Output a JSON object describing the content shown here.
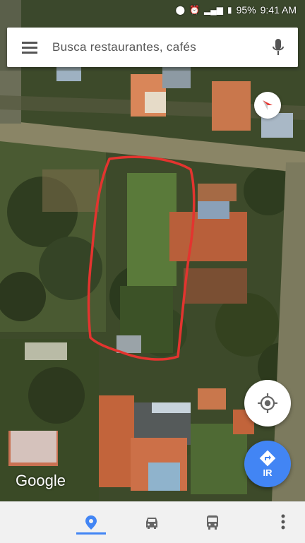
{
  "status_bar": {
    "battery": "95%",
    "time": "9:41 AM",
    "icons": [
      "location-icon",
      "alarm-icon",
      "signal-icon",
      "battery-icon"
    ]
  },
  "search": {
    "placeholder": "Busca restaurantes, cafés",
    "menu_icon": "hamburger-menu-icon",
    "mic_icon": "microphone-icon"
  },
  "map": {
    "type": "satellite",
    "provider_label": "Google",
    "annotation_color": "#e3342f"
  },
  "controls": {
    "compass_icon": "compass-icon",
    "locate_icon": "my-location-icon",
    "directions_label": "IR",
    "directions_color": "#4285f4"
  },
  "bottom_nav": {
    "tabs": [
      {
        "icon": "explore-pin-icon",
        "active": true
      },
      {
        "icon": "car-icon",
        "active": false
      },
      {
        "icon": "transit-icon",
        "active": false
      }
    ],
    "more_icon": "more-vert-icon",
    "accent": "#4285f4"
  }
}
